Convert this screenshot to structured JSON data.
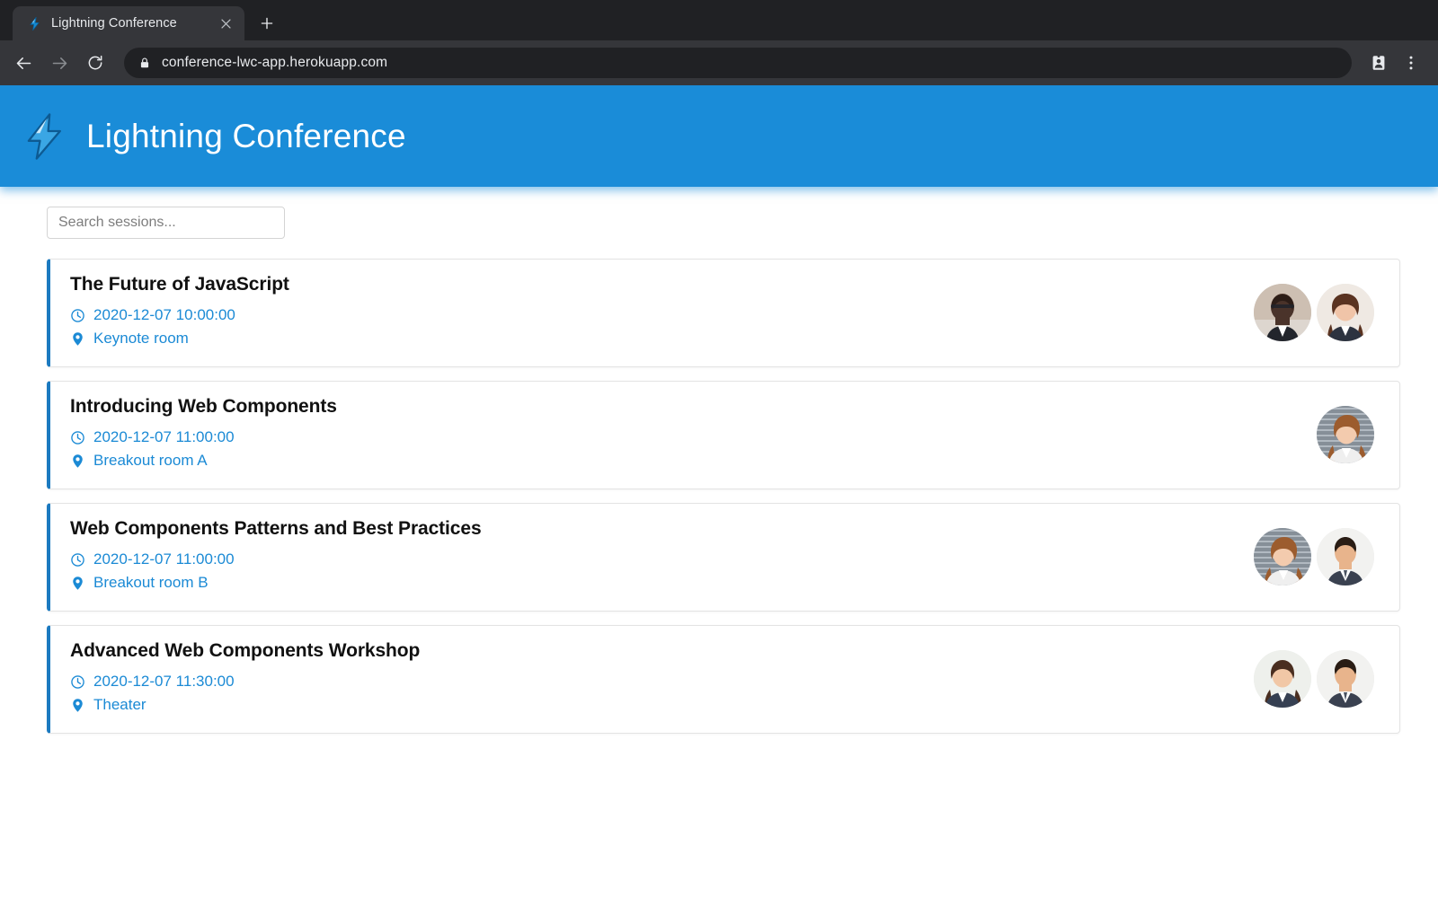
{
  "browser": {
    "tab": {
      "title": "Lightning Conference",
      "favicon": "lightning-bolt-icon",
      "close_icon": "close-icon"
    },
    "new_tab_icon": "plus-icon",
    "back_icon": "back-arrow-icon",
    "forward_icon": "forward-arrow-icon",
    "reload_icon": "reload-icon",
    "lock_icon": "lock-icon",
    "url": "conference-lwc-app.herokuapp.com",
    "profile_icon": "profile-badge-icon",
    "menu_icon": "three-dot-menu-icon"
  },
  "app": {
    "logo_icon": "lightning-bolt-icon",
    "title": "Lightning Conference",
    "header_color": "#1a8cd8"
  },
  "search": {
    "value": "",
    "placeholder": "Search sessions..."
  },
  "colors": {
    "accent": "#1b8ad5",
    "card_accent_border": "#1c7ac0",
    "title_text": "#111111"
  },
  "sessions": [
    {
      "title": "The Future of JavaScript",
      "time_icon": "clock-icon",
      "time": "2020-12-07 10:00:00",
      "location_icon": "map-pin-icon",
      "location": "Keynote room",
      "speakers": [
        "speaker-avatar-1",
        "speaker-avatar-2"
      ]
    },
    {
      "title": "Introducing Web Components",
      "time_icon": "clock-icon",
      "time": "2020-12-07 11:00:00",
      "location_icon": "map-pin-icon",
      "location": "Breakout room A",
      "speakers": [
        "speaker-avatar-3"
      ]
    },
    {
      "title": "Web Components Patterns and Best Practices",
      "time_icon": "clock-icon",
      "time": "2020-12-07 11:00:00",
      "location_icon": "map-pin-icon",
      "location": "Breakout room B",
      "speakers": [
        "speaker-avatar-3",
        "speaker-avatar-4"
      ]
    },
    {
      "title": "Advanced Web Components Workshop",
      "time_icon": "clock-icon",
      "time": "2020-12-07 11:30:00",
      "location_icon": "map-pin-icon",
      "location": "Theater",
      "speakers": [
        "speaker-avatar-5",
        "speaker-avatar-4"
      ]
    }
  ]
}
